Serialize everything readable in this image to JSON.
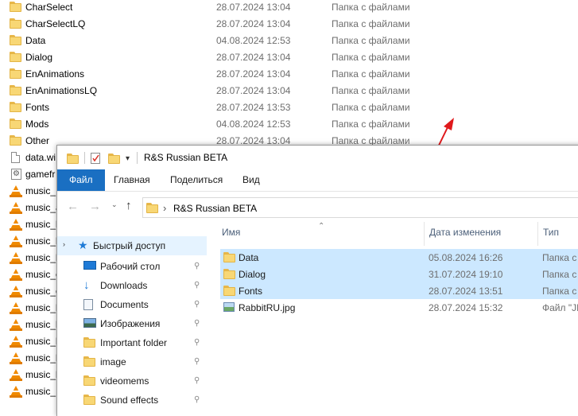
{
  "background_list": {
    "rows": [
      {
        "icon": "folder-icon",
        "name": "CharSelect",
        "date": "28.07.2024 13:04",
        "type": "Папка с файлами"
      },
      {
        "icon": "folder-icon",
        "name": "CharSelectLQ",
        "date": "28.07.2024 13:04",
        "type": "Папка с файлами"
      },
      {
        "icon": "folder-icon",
        "name": "Data",
        "date": "04.08.2024 12:53",
        "type": "Папка с файлами"
      },
      {
        "icon": "folder-icon",
        "name": "Dialog",
        "date": "28.07.2024 13:04",
        "type": "Папка с файлами"
      },
      {
        "icon": "folder-icon",
        "name": "EnAnimations",
        "date": "28.07.2024 13:04",
        "type": "Папка с файлами"
      },
      {
        "icon": "folder-icon",
        "name": "EnAnimationsLQ",
        "date": "28.07.2024 13:04",
        "type": "Папка с файлами"
      },
      {
        "icon": "folder-icon",
        "name": "Fonts",
        "date": "28.07.2024 13:53",
        "type": "Папка с файлами"
      },
      {
        "icon": "folder-icon",
        "name": "Mods",
        "date": "04.08.2024 12:53",
        "type": "Папка с файлами"
      },
      {
        "icon": "folder-icon",
        "name": "Other",
        "date": "28.07.2024 13:04",
        "type": "Папка с файлами"
      },
      {
        "icon": "document-icon",
        "name": "data.wi",
        "date": "",
        "type": ""
      },
      {
        "icon": "settings-file-icon",
        "name": "gamefr",
        "date": "",
        "type": ""
      },
      {
        "icon": "vlc-icon",
        "name": "music_",
        "date": "",
        "type": ""
      },
      {
        "icon": "vlc-icon",
        "name": "music_a",
        "date": "",
        "type": ""
      },
      {
        "icon": "vlc-icon",
        "name": "music_l",
        "date": "",
        "type": ""
      },
      {
        "icon": "vlc-icon",
        "name": "music_l",
        "date": "",
        "type": ""
      },
      {
        "icon": "vlc-icon",
        "name": "music_l",
        "date": "",
        "type": ""
      },
      {
        "icon": "vlc-icon",
        "name": "music_c",
        "date": "",
        "type": ""
      },
      {
        "icon": "vlc-icon",
        "name": "music_c",
        "date": "",
        "type": ""
      },
      {
        "icon": "vlc-icon",
        "name": "music_l",
        "date": "",
        "type": ""
      },
      {
        "icon": "vlc-icon",
        "name": "music_l",
        "date": "",
        "type": ""
      },
      {
        "icon": "vlc-icon",
        "name": "music_l",
        "date": "",
        "type": ""
      },
      {
        "icon": "vlc-icon",
        "name": "music_l",
        "date": "",
        "type": ""
      },
      {
        "icon": "vlc-icon",
        "name": "music_l",
        "date": "",
        "type": ""
      },
      {
        "icon": "vlc-icon",
        "name": "music_",
        "date": "",
        "type": ""
      }
    ]
  },
  "window": {
    "title": "R&S Russian BETA",
    "ribbon_tabs": [
      "Файл",
      "Главная",
      "Поделиться",
      "Вид"
    ],
    "address": {
      "path": "R&S Russian BETA",
      "separator": "›"
    },
    "nav_header": "Быстрый доступ",
    "nav_items": [
      {
        "icon": "desktop-icon",
        "label": "Рабочий стол"
      },
      {
        "icon": "downloads-icon",
        "label": "Downloads"
      },
      {
        "icon": "documents-icon",
        "label": "Documents"
      },
      {
        "icon": "pictures-icon",
        "label": "Изображения"
      },
      {
        "icon": "folder-icon",
        "label": "Important folder"
      },
      {
        "icon": "folder-icon",
        "label": "image"
      },
      {
        "icon": "folder-icon",
        "label": "videomems"
      },
      {
        "icon": "folder-icon",
        "label": "Sound effects"
      }
    ],
    "columns": {
      "name": "Имя",
      "date": "Дата изменения",
      "type": "Тип"
    },
    "files": [
      {
        "icon": "folder-icon",
        "name": "Data",
        "date": "05.08.2024 16:26",
        "type": "Папка с",
        "selected": true
      },
      {
        "icon": "folder-icon",
        "name": "Dialog",
        "date": "31.07.2024 19:10",
        "type": "Папка с",
        "selected": true
      },
      {
        "icon": "folder-icon",
        "name": "Fonts",
        "date": "28.07.2024 13:51",
        "type": "Папка с",
        "selected": true
      },
      {
        "icon": "image-file-icon",
        "name": "RabbitRU.jpg",
        "date": "28.07.2024 15:32",
        "type": "Файл \"JF",
        "selected": false
      }
    ]
  },
  "colors": {
    "accent": "#1a6fc2",
    "selection": "#cce8ff",
    "arrow": "#e0191c",
    "folder": "#f8d775"
  }
}
